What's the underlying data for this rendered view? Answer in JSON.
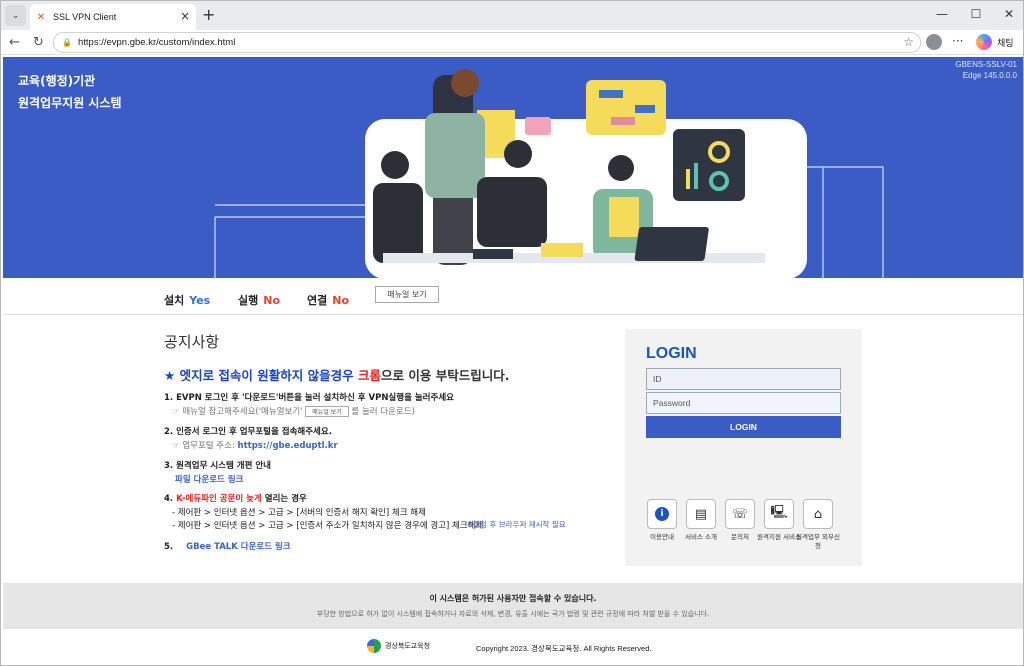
{
  "browser": {
    "tab_title": "SSL VPN Client",
    "url": "https://evpn.gbe.kr/custom/index.html",
    "chat_label": "채팅"
  },
  "hero": {
    "org_line1": "교육(행정)기관",
    "org_line2": "원격업무지원 시스템",
    "version_line1": "GBENS-SSLV-01",
    "version_line2": "Edge 145.0.0.0"
  },
  "status": {
    "install_label": "설치",
    "install_value": "Yes",
    "run_label": "실행",
    "run_value": "No",
    "connect_label": "연결",
    "connect_value": "No",
    "manual_button": "매뉴얼 보기"
  },
  "notice": {
    "title": "공지사항",
    "headline_star": "★",
    "headline_blue": "엣지로 접속이 원활하지 않을경우",
    "headline_red": "크롬",
    "headline_rest": "으로 이용 부탁드립니다.",
    "item1": "1. EVPN 로그인 후 '다운로드'버튼을 눌러 설치하신 후 VPN실행을 눌러주세요",
    "item1_sub_a": "☞ 매뉴얼 참고해주세요('매뉴얼보기'",
    "item1_sub_btn": "매뉴얼 보기",
    "item1_sub_b": "를 눌러 다운로드)",
    "item2": "2. 인증서 로그인 후 업무포털을 접속해주세요.",
    "item2_sub": "☞ 업무포털 주소:",
    "item2_link": "https://gbe.eduptl.kr",
    "item3": "3. 원격업무 시스템 개편 안내",
    "item3_link": "파일 다운로드 링크",
    "item4_num": "4.",
    "item4_red": "K-에듀파인 공문이 늦게",
    "item4_rest": "열리는 경우",
    "item4_a": "- 제어판 > 인터넷 옵션 > 고급 > [서버의 인증서 해지 확인] 체크 해제",
    "item4_b": "- 제어판 > 인터넷 옵션 > 고급 > [인증서 주소가 일치하지 않은 경우에 경고] 체크해제",
    "item4_note": "※설정 후 브라우저 재시작 필요",
    "item5_num": "5.",
    "item5_link": "GBee TALK 다운로드 링크"
  },
  "login": {
    "title": "LOGIN",
    "id_placeholder": "ID",
    "pw_placeholder": "Password",
    "button": "LOGIN",
    "quick": [
      {
        "icon": "info-icon",
        "label": "이용안내"
      },
      {
        "icon": "document-icon",
        "label": "서비스 소개"
      },
      {
        "icon": "phone-icon",
        "label": "문의처"
      },
      {
        "icon": "computer-icon",
        "label": "원격지원 서비스"
      },
      {
        "icon": "remote-icon",
        "label": "원격업무 외부신청"
      }
    ]
  },
  "footer": {
    "line1": "이 시스템은 허가된 사용자만 접속할 수 있습니다.",
    "line2": "부당한 방법으로 허가 없이 시스템에 접속하거나 자료의 삭제, 변경, 유출 시에는 국가 법령 및 관련 규정에 따라 처벌 받을 수 있습니다.",
    "logo_text": "경상북도교육청",
    "copyright": "Copyright 2023. 경상북도교육청. All Rights Reserved."
  }
}
